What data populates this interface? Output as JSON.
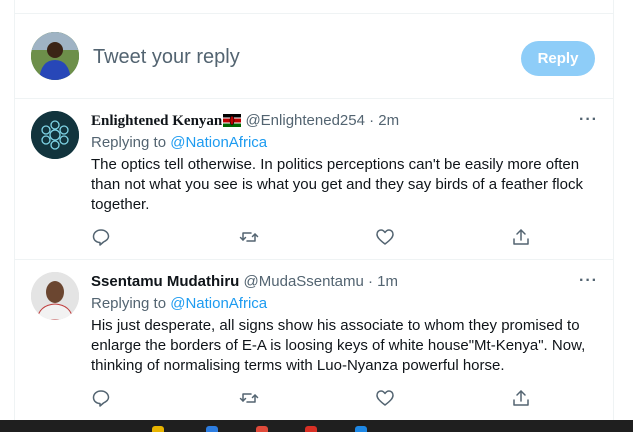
{
  "compose": {
    "placeholder": "Tweet your reply",
    "reply_label": "Reply"
  },
  "tweets": [
    {
      "name": "Enlightened Kenyan",
      "flag": "Kenya flag",
      "handle": "@Enlightened254",
      "sep": "·",
      "time": "2m",
      "replying_prefix": "Replying to",
      "replying_to": "@NationAfrica",
      "text": "The optics tell otherwise. In politics perceptions can't be easily more often than not what you see is what you get and they say birds of a feather flock together.",
      "more": "···"
    },
    {
      "name": "Ssentamu Mudathiru",
      "handle": "@MudaSsentamu",
      "sep": "·",
      "time": "1m",
      "replying_prefix": "Replying to",
      "replying_to": "@NationAfrica",
      "text": "His just desperate, all signs show his associate to whom they promised to enlarge the borders of E-A is loosing keys of white house\"Mt-Kenya\". Now, thinking of normalising terms with Luo-Nyanza powerful horse.",
      "more": "···"
    }
  ],
  "colors": {
    "accent": "#1d9bf0",
    "reply_button": "#8ecdf8",
    "muted": "#536471"
  },
  "icons": [
    "reply-icon",
    "retweet-icon",
    "like-icon",
    "share-icon",
    "more-icon"
  ]
}
